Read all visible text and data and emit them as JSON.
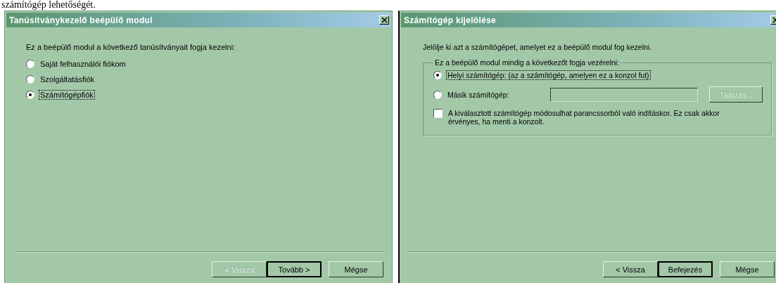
{
  "caption": "számítógép lehetőségét.",
  "dialogs": [
    {
      "title": "Tanúsítványkezelő beépülő modul",
      "intro": "Ez a beépülő modul a következő tanúsítványait fogja kezelni:",
      "options": [
        {
          "kind": "radio",
          "label": "Saját felhasználói fiókom",
          "selected": false
        },
        {
          "kind": "radio",
          "label": "Szolgáltatásfiók",
          "selected": false
        },
        {
          "kind": "radio",
          "label": "Számítógépfiók",
          "selected": true
        }
      ],
      "buttons": [
        {
          "label": "< Vissza",
          "disabled": true,
          "default": false
        },
        {
          "label": "Tovább >",
          "disabled": false,
          "default": true
        },
        {
          "label": "Mégse",
          "disabled": false,
          "default": false
        }
      ]
    },
    {
      "title": "Számítógép kijelölése",
      "intro": "Jelölje ki azt a számítógépet, amelyet ez a beépülő modul fog kezelni.",
      "group_label": "Ez a beépülő modul mindig a következőt fogja vezérelni:",
      "options": [
        {
          "kind": "radio",
          "label": "Helyi számítógép: (az a számítógép, amelyen ez a konzol fut)",
          "selected": true
        },
        {
          "kind": "radio_field",
          "label": "Másik számítógép:",
          "selected": false,
          "browse": "Tallózás..."
        },
        {
          "kind": "checkbox",
          "label": "A kiválasztott számítógép módosulhat parancssorból való indításkor. Ez csak akkor érvényes, ha menti a konzolt.",
          "checked": false
        }
      ],
      "buttons": [
        {
          "label": "< Vissza",
          "disabled": false,
          "default": false
        },
        {
          "label": "Befejezés",
          "disabled": false,
          "default": true
        },
        {
          "label": "Mégse",
          "disabled": false,
          "default": false
        }
      ]
    }
  ]
}
